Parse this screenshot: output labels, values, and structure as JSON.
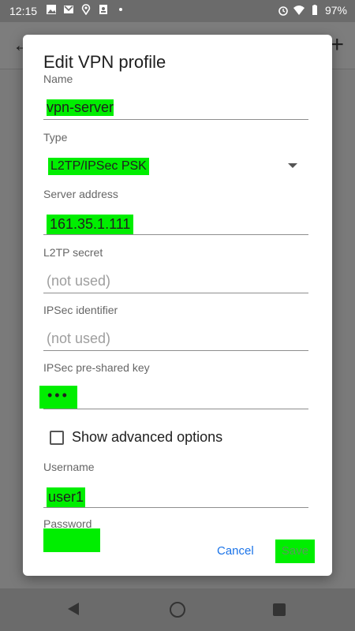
{
  "status_bar": {
    "time": "12:15",
    "left_icons": [
      "image-icon",
      "gmail-icon",
      "maps-icon",
      "portrait-icon",
      "dot-icon"
    ],
    "right_icons": [
      "alarm-icon",
      "wifi-icon",
      "battery-icon"
    ],
    "battery": "97%"
  },
  "dialog": {
    "title": "Edit VPN profile",
    "fields": {
      "name": {
        "label": "Name",
        "value": "vpn-server"
      },
      "type": {
        "label": "Type",
        "value": "L2TP/IPSec PSK"
      },
      "server": {
        "label": "Server address",
        "value": "161.35.1.111"
      },
      "l2tp_secret": {
        "label": "L2TP secret",
        "placeholder": "(not used)"
      },
      "ipsec_id": {
        "label": "IPSec identifier",
        "placeholder": "(not used)"
      },
      "ipsec_psk": {
        "label": "IPSec pre-shared key",
        "value": "•••"
      },
      "username": {
        "label": "Username",
        "value": "user1"
      },
      "password": {
        "label": "Password"
      }
    },
    "show_advanced": {
      "label": "Show advanced options",
      "checked": false
    },
    "buttons": {
      "cancel": "Cancel",
      "save": "Save"
    }
  },
  "colors": {
    "highlight": "#00ee00",
    "accent": "#1a73e8"
  }
}
